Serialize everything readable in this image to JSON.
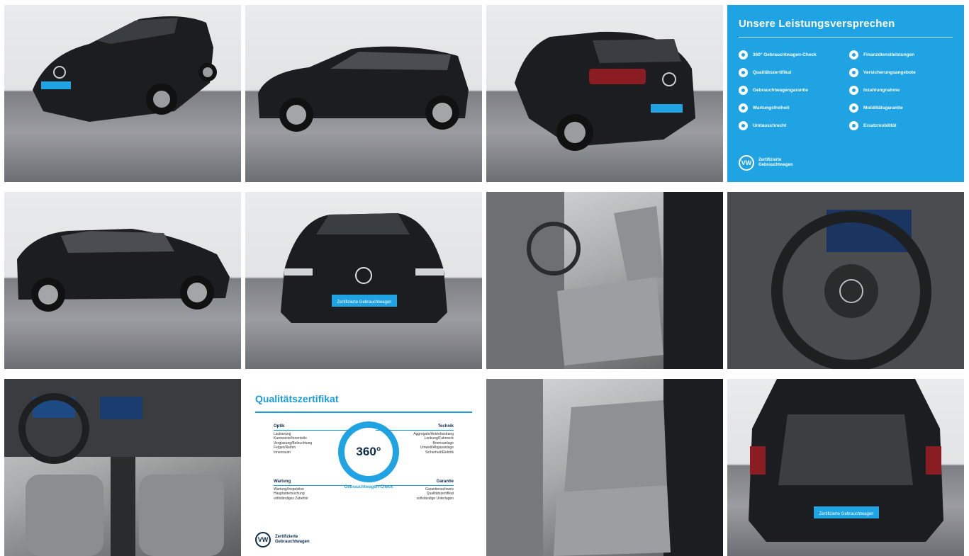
{
  "gallery": {
    "tiles": [
      {
        "kind": "photo",
        "name": "front-three-quarter"
      },
      {
        "kind": "photo",
        "name": "side-right"
      },
      {
        "kind": "photo",
        "name": "rear-three-quarter"
      },
      {
        "kind": "promise"
      },
      {
        "kind": "photo",
        "name": "side-left"
      },
      {
        "kind": "photo",
        "name": "front"
      },
      {
        "kind": "photo",
        "name": "front-seats"
      },
      {
        "kind": "photo",
        "name": "steering-wheel"
      },
      {
        "kind": "photo",
        "name": "dashboard"
      },
      {
        "kind": "cert"
      },
      {
        "kind": "photo",
        "name": "rear-seats"
      },
      {
        "kind": "photo",
        "name": "trunk"
      }
    ]
  },
  "promise": {
    "title": "Unsere Leistungsversprechen",
    "left": [
      "360° Gebrauchtwagen-Check",
      "Qualitätszertifikat",
      "Gebrauchtwagengarantie",
      "Wartungsfreiheit",
      "Umtauschrecht"
    ],
    "right": [
      "Finanzdienstleistungen",
      "Versicherungsangebote",
      "Inzahlungnahme",
      "Mobilitätsgarantie",
      "Ersatzmobilität"
    ],
    "brand_line1": "Zertifizierte",
    "brand_line2": "Gebrauchtwagen",
    "logo": "VW"
  },
  "plate": {
    "text": "Zertifizierte Gebrauchtwagen"
  },
  "cert": {
    "title": "Qualitätszertifikat",
    "ring": "360°",
    "ring_caption": "Gebrauchtwagen-Check",
    "optik": {
      "title": "Optik",
      "items": [
        "Lackierung",
        "Karosserie/Innenteile",
        "Verglasung/Beleuchtung",
        "Felgen/Reifen",
        "Innenraum"
      ]
    },
    "technik": {
      "title": "Technik",
      "items": [
        "Aggregate/Antriebsstrang",
        "Lenkung/Fahrwerk",
        "Bremsanlage",
        "Umwelt/Abgasanlage",
        "Sicherheit/Elektrik"
      ]
    },
    "wartung": {
      "title": "Wartung",
      "items": [
        "Wartung/Inspektion",
        "Hauptuntersuchung",
        "vollständiges Zubehör"
      ]
    },
    "garantie": {
      "title": "Garantie",
      "items": [
        "Garantienachweis",
        "Qualitätszertifikat",
        "vollständige Unterlagen"
      ]
    },
    "brand_line1": "Zertifizierte",
    "brand_line2": "Gebrauchtwagen",
    "logo": "VW"
  },
  "colors": {
    "accent": "#1fa3e3",
    "car": "#1c1d20",
    "navy": "#0b2a4a"
  }
}
